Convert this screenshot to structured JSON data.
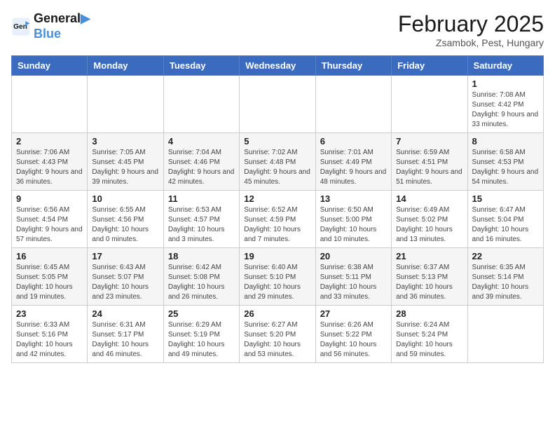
{
  "logo": {
    "line1": "General",
    "line2": "Blue"
  },
  "title": "February 2025",
  "location": "Zsambok, Pest, Hungary",
  "days_header": [
    "Sunday",
    "Monday",
    "Tuesday",
    "Wednesday",
    "Thursday",
    "Friday",
    "Saturday"
  ],
  "weeks": [
    [
      {
        "day": "",
        "info": ""
      },
      {
        "day": "",
        "info": ""
      },
      {
        "day": "",
        "info": ""
      },
      {
        "day": "",
        "info": ""
      },
      {
        "day": "",
        "info": ""
      },
      {
        "day": "",
        "info": ""
      },
      {
        "day": "1",
        "info": "Sunrise: 7:08 AM\nSunset: 4:42 PM\nDaylight: 9 hours and 33 minutes."
      }
    ],
    [
      {
        "day": "2",
        "info": "Sunrise: 7:06 AM\nSunset: 4:43 PM\nDaylight: 9 hours and 36 minutes."
      },
      {
        "day": "3",
        "info": "Sunrise: 7:05 AM\nSunset: 4:45 PM\nDaylight: 9 hours and 39 minutes."
      },
      {
        "day": "4",
        "info": "Sunrise: 7:04 AM\nSunset: 4:46 PM\nDaylight: 9 hours and 42 minutes."
      },
      {
        "day": "5",
        "info": "Sunrise: 7:02 AM\nSunset: 4:48 PM\nDaylight: 9 hours and 45 minutes."
      },
      {
        "day": "6",
        "info": "Sunrise: 7:01 AM\nSunset: 4:49 PM\nDaylight: 9 hours and 48 minutes."
      },
      {
        "day": "7",
        "info": "Sunrise: 6:59 AM\nSunset: 4:51 PM\nDaylight: 9 hours and 51 minutes."
      },
      {
        "day": "8",
        "info": "Sunrise: 6:58 AM\nSunset: 4:53 PM\nDaylight: 9 hours and 54 minutes."
      }
    ],
    [
      {
        "day": "9",
        "info": "Sunrise: 6:56 AM\nSunset: 4:54 PM\nDaylight: 9 hours and 57 minutes."
      },
      {
        "day": "10",
        "info": "Sunrise: 6:55 AM\nSunset: 4:56 PM\nDaylight: 10 hours and 0 minutes."
      },
      {
        "day": "11",
        "info": "Sunrise: 6:53 AM\nSunset: 4:57 PM\nDaylight: 10 hours and 3 minutes."
      },
      {
        "day": "12",
        "info": "Sunrise: 6:52 AM\nSunset: 4:59 PM\nDaylight: 10 hours and 7 minutes."
      },
      {
        "day": "13",
        "info": "Sunrise: 6:50 AM\nSunset: 5:00 PM\nDaylight: 10 hours and 10 minutes."
      },
      {
        "day": "14",
        "info": "Sunrise: 6:49 AM\nSunset: 5:02 PM\nDaylight: 10 hours and 13 minutes."
      },
      {
        "day": "15",
        "info": "Sunrise: 6:47 AM\nSunset: 5:04 PM\nDaylight: 10 hours and 16 minutes."
      }
    ],
    [
      {
        "day": "16",
        "info": "Sunrise: 6:45 AM\nSunset: 5:05 PM\nDaylight: 10 hours and 19 minutes."
      },
      {
        "day": "17",
        "info": "Sunrise: 6:43 AM\nSunset: 5:07 PM\nDaylight: 10 hours and 23 minutes."
      },
      {
        "day": "18",
        "info": "Sunrise: 6:42 AM\nSunset: 5:08 PM\nDaylight: 10 hours and 26 minutes."
      },
      {
        "day": "19",
        "info": "Sunrise: 6:40 AM\nSunset: 5:10 PM\nDaylight: 10 hours and 29 minutes."
      },
      {
        "day": "20",
        "info": "Sunrise: 6:38 AM\nSunset: 5:11 PM\nDaylight: 10 hours and 33 minutes."
      },
      {
        "day": "21",
        "info": "Sunrise: 6:37 AM\nSunset: 5:13 PM\nDaylight: 10 hours and 36 minutes."
      },
      {
        "day": "22",
        "info": "Sunrise: 6:35 AM\nSunset: 5:14 PM\nDaylight: 10 hours and 39 minutes."
      }
    ],
    [
      {
        "day": "23",
        "info": "Sunrise: 6:33 AM\nSunset: 5:16 PM\nDaylight: 10 hours and 42 minutes."
      },
      {
        "day": "24",
        "info": "Sunrise: 6:31 AM\nSunset: 5:17 PM\nDaylight: 10 hours and 46 minutes."
      },
      {
        "day": "25",
        "info": "Sunrise: 6:29 AM\nSunset: 5:19 PM\nDaylight: 10 hours and 49 minutes."
      },
      {
        "day": "26",
        "info": "Sunrise: 6:27 AM\nSunset: 5:20 PM\nDaylight: 10 hours and 53 minutes."
      },
      {
        "day": "27",
        "info": "Sunrise: 6:26 AM\nSunset: 5:22 PM\nDaylight: 10 hours and 56 minutes."
      },
      {
        "day": "28",
        "info": "Sunrise: 6:24 AM\nSunset: 5:24 PM\nDaylight: 10 hours and 59 minutes."
      },
      {
        "day": "",
        "info": ""
      }
    ]
  ]
}
